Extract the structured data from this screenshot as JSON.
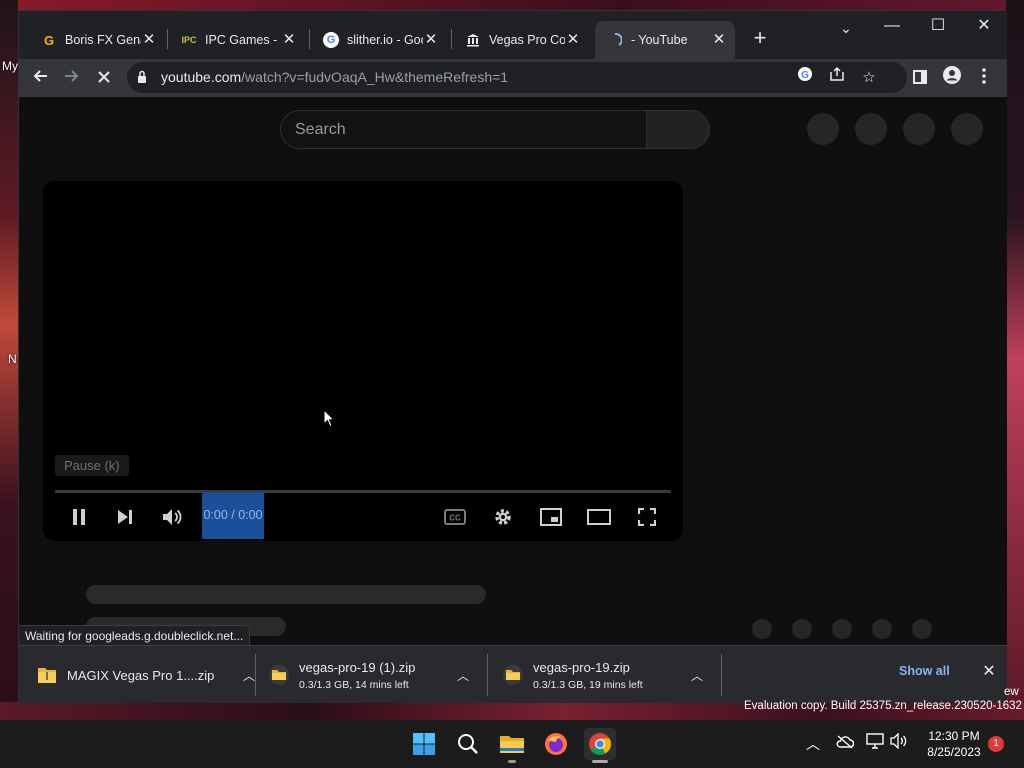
{
  "desktop": {
    "left_labels": [
      "My",
      "N"
    ],
    "eval_text": "Evaluation copy. Build 25375.zn_release.230520-1632",
    "eval_text_fragment": "ew"
  },
  "browser": {
    "tabs": [
      {
        "label": "Boris FX Genar",
        "favicon": "G",
        "favicon_color": "#f5b400",
        "active": false
      },
      {
        "label": "IPC Games - IP",
        "favicon": "IPC",
        "favicon_color": "#c9c040",
        "active": false
      },
      {
        "label": "slither.io - Goo",
        "favicon": "G",
        "favicon_color": "#4285f4",
        "active": false
      },
      {
        "label": "Vegas Pro Coll",
        "favicon": "bank-icon",
        "favicon_color": "#e8eaed",
        "active": false
      },
      {
        "label": "- YouTube",
        "favicon": "loading-spinner-icon",
        "favicon_color": "#8ab4f8",
        "active": true
      }
    ],
    "new_tab_label": "+",
    "window_controls": {
      "minimize": "—",
      "maximize": "☐",
      "close": "✕",
      "tab_search": "⌄"
    },
    "url": {
      "host": "youtube.com",
      "path": "/watch?v=fudvOaqA_Hw&themeRefresh=1"
    }
  },
  "page": {
    "search_placeholder": "Search",
    "player": {
      "tooltip": "Pause (k)",
      "time": "0:00 / 0:00"
    },
    "status_text": "Waiting for googleads.g.doubleclick.net..."
  },
  "downloads": {
    "items": [
      {
        "name": "MAGIX Vegas Pro 1....zip",
        "sub": ""
      },
      {
        "name": "vegas-pro-19 (1).zip",
        "sub": "0.3/1.3 GB, 14 mins left"
      },
      {
        "name": "vegas-pro-19.zip",
        "sub": "0.3/1.3 GB, 19 mins left"
      }
    ],
    "show_all": "Show all"
  },
  "taskbar": {
    "time": "12:30 PM",
    "date": "8/25/2023",
    "notification_count": "1"
  },
  "colors": {
    "accent_blue": "#8ab4f8",
    "time_highlight": "#1a4f9a"
  }
}
